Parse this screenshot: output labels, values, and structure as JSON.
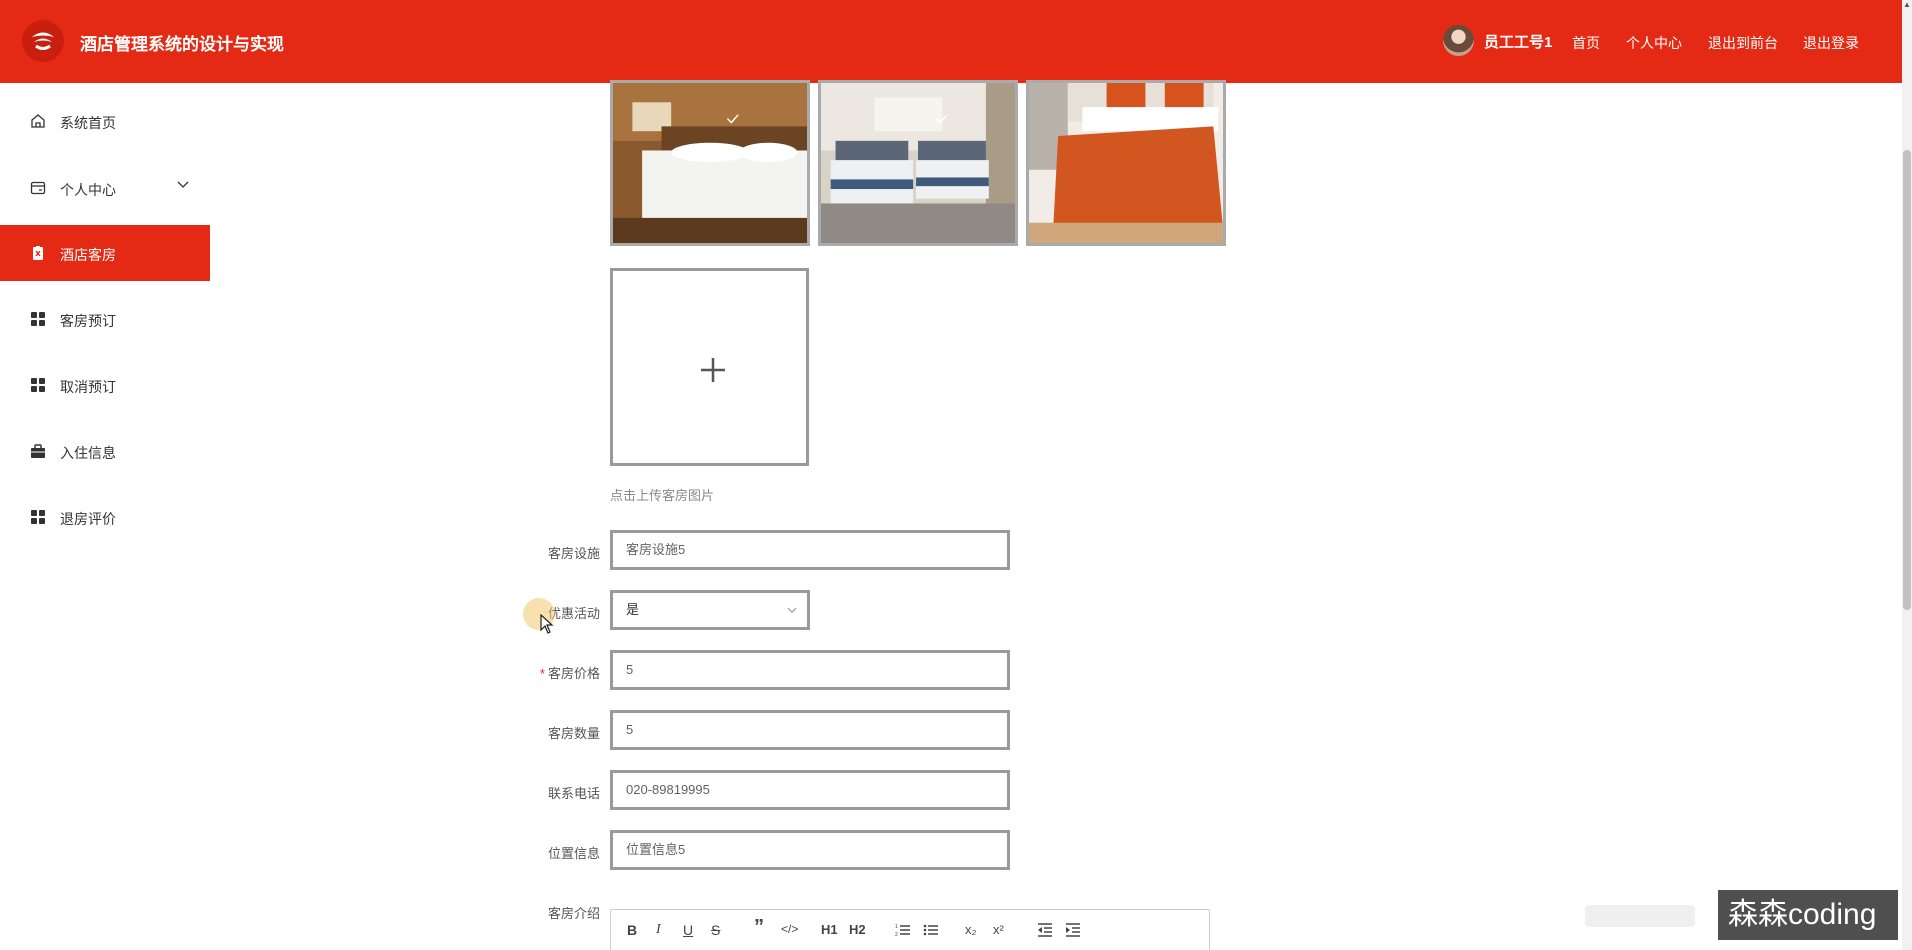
{
  "header": {
    "app_title": "酒店管理系统的设计与实现",
    "username": "员工工号1",
    "nav": [
      "首页",
      "个人中心",
      "退出到前台",
      "退出登录"
    ]
  },
  "sidebar": {
    "items": [
      {
        "label": "系统首页",
        "icon": "home-icon"
      },
      {
        "label": "个人中心",
        "icon": "id-card-icon"
      },
      {
        "label": "酒店客房",
        "icon": "room-icon",
        "active": true
      },
      {
        "label": "客房预订",
        "icon": "grid-icon"
      },
      {
        "label": "取消预订",
        "icon": "grid-icon"
      },
      {
        "label": "入住信息",
        "icon": "briefcase-icon"
      },
      {
        "label": "退房评价",
        "icon": "grid-icon"
      }
    ]
  },
  "upload": {
    "hint": "点击上传客房图片"
  },
  "form": {
    "facilities": {
      "label": "客房设施",
      "value": "客房设施5"
    },
    "promotion": {
      "label": "优惠活动",
      "value": "是"
    },
    "price": {
      "label": "客房价格",
      "required_mark": "*",
      "value": "5"
    },
    "quantity": {
      "label": "客房数量",
      "value": "5"
    },
    "phone": {
      "label": "联系电话",
      "value": "020-89819995"
    },
    "location": {
      "label": "位置信息",
      "value": "位置信息5"
    },
    "intro": {
      "label": "客房介绍"
    }
  },
  "editor_toolbar": [
    "B",
    "I",
    "U",
    "S",
    "”",
    "</>",
    "H1",
    "H2",
    "ordered-list",
    "bullet-list",
    "x₂",
    "x²",
    "outdent",
    "indent"
  ],
  "watermark": "森森coding",
  "colors": {
    "accent": "#e42a14",
    "border": "#999999"
  }
}
